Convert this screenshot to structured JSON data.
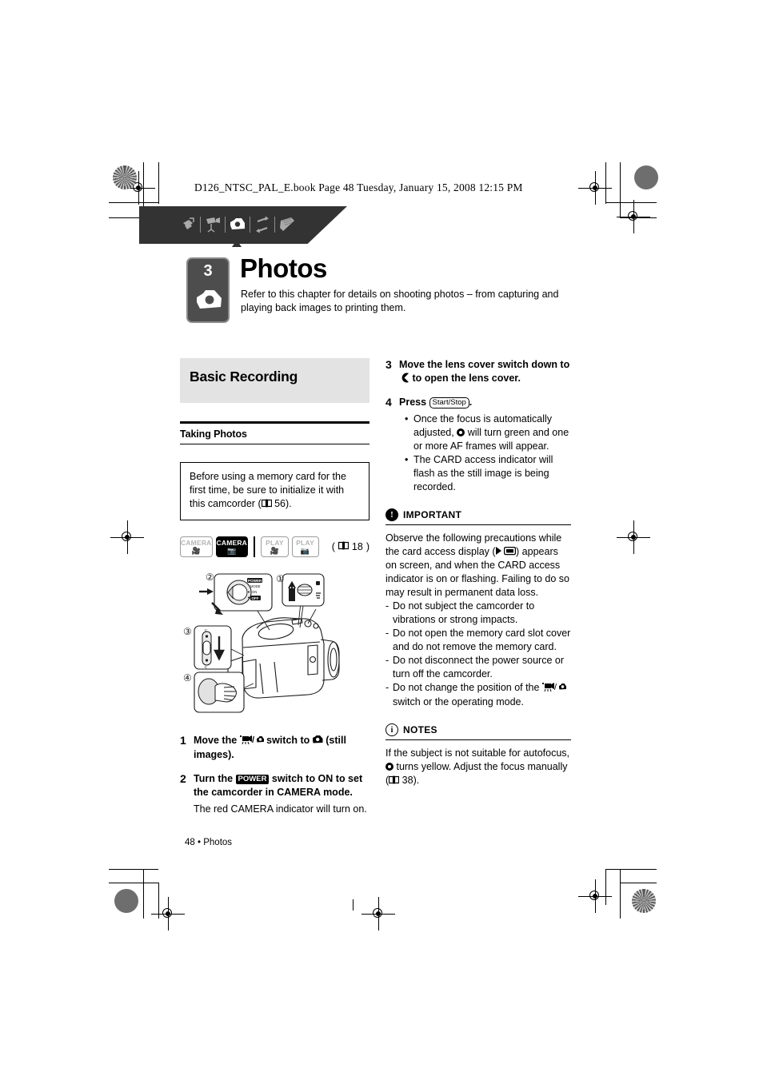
{
  "page": {
    "ebook_header": "D126_NTSC_PAL_E.book  Page 48  Tuesday, January 15, 2008  12:15 PM",
    "footer_page": "48",
    "footer_bullet": "•",
    "footer_label": "Photos"
  },
  "tabbar": {
    "icons": [
      {
        "name": "intro-hand-icon",
        "glyph": "☝"
      },
      {
        "name": "video-camera-icon",
        "glyph": "🎥"
      },
      {
        "name": "photo-camera-icon",
        "glyph": "📷"
      },
      {
        "name": "transfer-arrows-icon",
        "glyph": "⇄"
      },
      {
        "name": "book-icon",
        "glyph": "📕"
      }
    ]
  },
  "chapter": {
    "number": "3",
    "title": "Photos",
    "description": "Refer to this chapter for details on shooting photos – from capturing and playing back images to printing them."
  },
  "left_column": {
    "section_title": "Basic Recording",
    "sub_title": "Taking Photos",
    "note_box": "Before using a memory card for the first time, be sure to initialize it with this camcorder (",
    "note_box_page": "56",
    "note_box_tail": ").",
    "modes": [
      {
        "label": "CAMERA",
        "glyph": "video",
        "active": false
      },
      {
        "label": "CAMERA",
        "glyph": "photo",
        "active": true
      },
      {
        "label": "PLAY",
        "glyph": "video",
        "active": false
      },
      {
        "label": "PLAY",
        "glyph": "photo",
        "active": false
      }
    ],
    "mode_page_ref": "18",
    "illustration_callouts": [
      "①",
      "②",
      "③",
      "④"
    ],
    "illustration_labels": {
      "power_dial": "POWER",
      "mode_label": "MODE",
      "on_label": "ON",
      "off_label": "OFF"
    },
    "steps": [
      {
        "number": "1",
        "text_before": "Move the ",
        "glyph": "video/photo-switch",
        "text_mid": " switch to ",
        "glyph2": "photo",
        "text_after": " (still images)."
      },
      {
        "number": "2",
        "text_before": "Turn the ",
        "glyph": "POWER",
        "text_after": " switch to ON to set the camcorder in CAMERA mode.",
        "sub": "The red CAMERA indicator will turn on."
      }
    ]
  },
  "right_column": {
    "steps": [
      {
        "number": "3",
        "text_before": "Move the lens cover switch down to ",
        "glyph": "lens-cover",
        "text_after": " to open the lens cover."
      },
      {
        "number": "4",
        "text_before": "Press ",
        "glyph": "Start/Stop",
        "text_after": ".",
        "bullets": [
          "Once the focus is automatically adjusted, ◉ will turn green and one or more AF frames will appear.",
          "The CARD access indicator will flash as the still image is being recorded."
        ],
        "bullet_1a": "Once the focus is automatically adjusted, ",
        "bullet_1b": " will turn green and one or more AF frames will appear.",
        "bullet_2": "The CARD access indicator will flash as the still image is being recorded."
      }
    ],
    "important": {
      "heading": "IMPORTANT",
      "body_a": "Observe the following precautions while the card access display (",
      "body_b": ") appears on screen, and when the CARD access indicator is on or flashing. Failing to do so may result in permanent data loss.",
      "items": [
        "Do not subject the camcorder to vibrations or strong impacts.",
        "Do not open the memory card slot cover and do not remove the memory card.",
        "Do not disconnect the power source or turn off the camcorder."
      ],
      "item_last_a": "Do not change the position of the ",
      "item_last_b": " switch or the operating mode."
    },
    "notes": {
      "heading": "NOTES",
      "body_a": "If the subject is not suitable for autofocus, ",
      "body_b": " turns yellow. Adjust the focus manually (",
      "page": "38",
      "body_c": ")."
    }
  }
}
